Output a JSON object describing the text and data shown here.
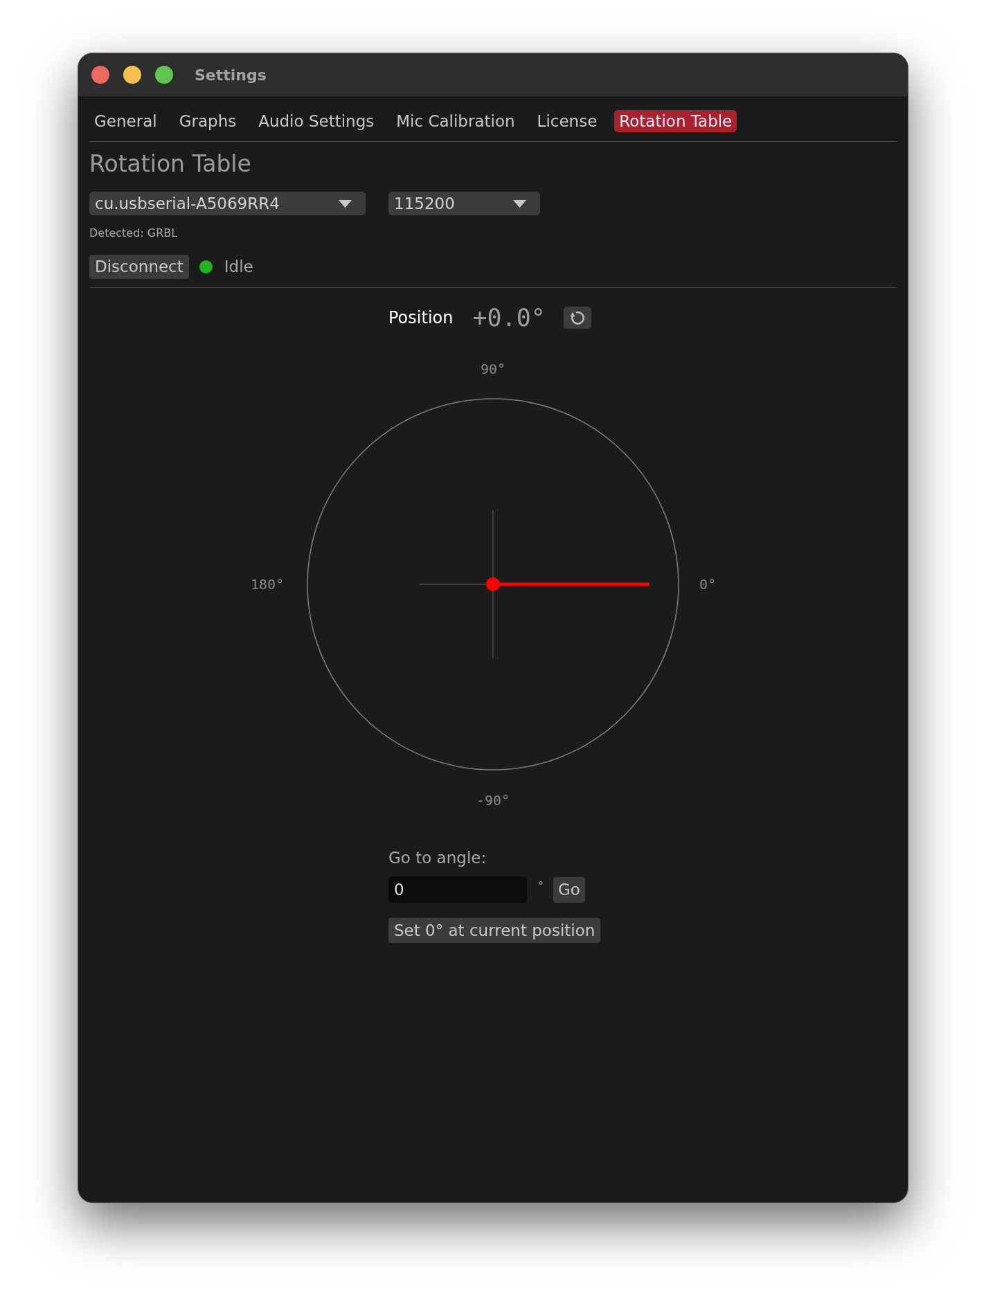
{
  "window": {
    "title": "Settings"
  },
  "tabs": [
    {
      "label": "General",
      "selected": false
    },
    {
      "label": "Graphs",
      "selected": false
    },
    {
      "label": "Audio Settings",
      "selected": false
    },
    {
      "label": "Mic Calibration",
      "selected": false
    },
    {
      "label": "License",
      "selected": false
    },
    {
      "label": "Rotation Table",
      "selected": true
    }
  ],
  "page": {
    "title": "Rotation Table"
  },
  "port_select": {
    "value": "cu.usbserial-A5069RR4"
  },
  "baud_select": {
    "value": "115200"
  },
  "detected": "Detected: GRBL",
  "connection": {
    "button": "Disconnect",
    "status": "Idle",
    "color": "#22b422"
  },
  "position": {
    "label": "Position",
    "reading": "+0.0°"
  },
  "dial": {
    "labels": [
      "90°",
      "180°",
      "0°",
      "-90°"
    ]
  },
  "go_to": {
    "label": "Go to angle:",
    "value": "0",
    "unit": "°",
    "button": "Go"
  },
  "zero_button": {
    "label": "Set 0° at current position"
  }
}
